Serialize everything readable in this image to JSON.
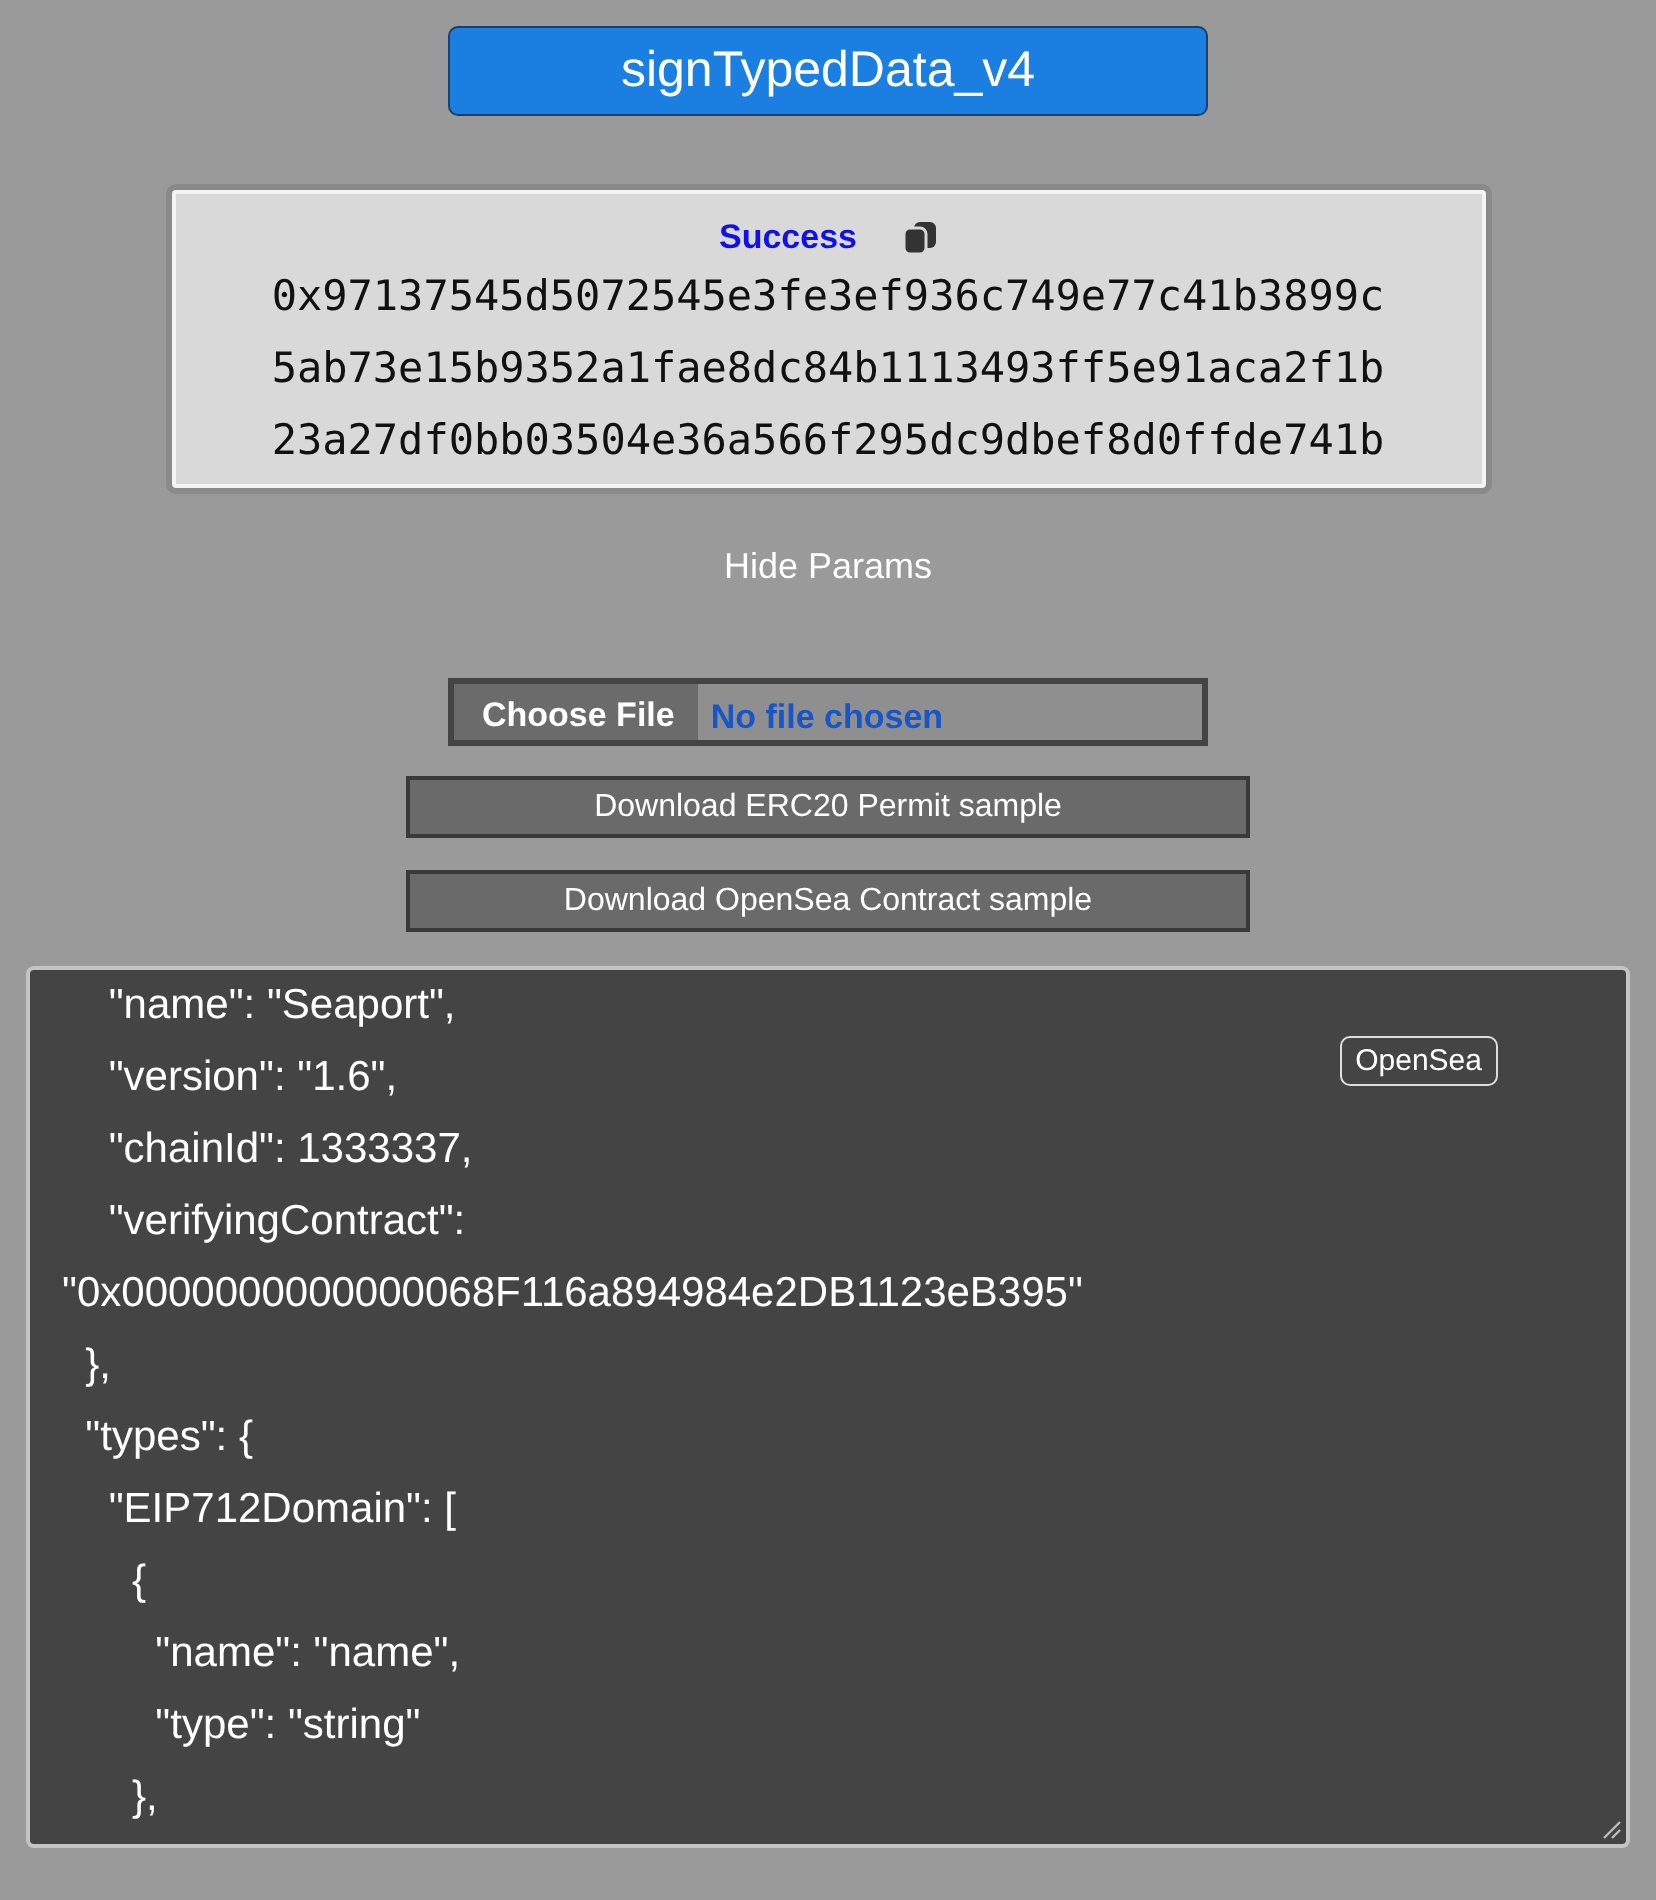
{
  "title_button": "signTypedData_v4",
  "result": {
    "status": "Success",
    "lines": [
      "0x97137545d5072545e3fe3ef936c749e77c41b3899c",
      "5ab73e15b9352a1fae8dc84b1113493ff5e91aca2f1b",
      "23a27df0bb03504e36a566f295dc9dbef8d0ffde741b"
    ]
  },
  "toggle_link": "Hide Params",
  "file_input": {
    "button": "Choose File",
    "status": "No file chosen"
  },
  "buttons": [
    "Download ERC20 Permit sample",
    "Download OpenSea Contract sample"
  ],
  "editor": {
    "badge": "OpenSea",
    "lines": [
      "    \"name\": \"Seaport\",",
      "    \"version\": \"1.6\",",
      "    \"chainId\": 1333337,",
      "    \"verifyingContract\":",
      "\"0x0000000000000068F116a894984e2DB1123eB395\"",
      "  },",
      "  \"types\": {",
      "    \"EIP712Domain\": [",
      "      {",
      "        \"name\": \"name\",",
      "        \"type\": \"string\"",
      "      },"
    ]
  }
}
